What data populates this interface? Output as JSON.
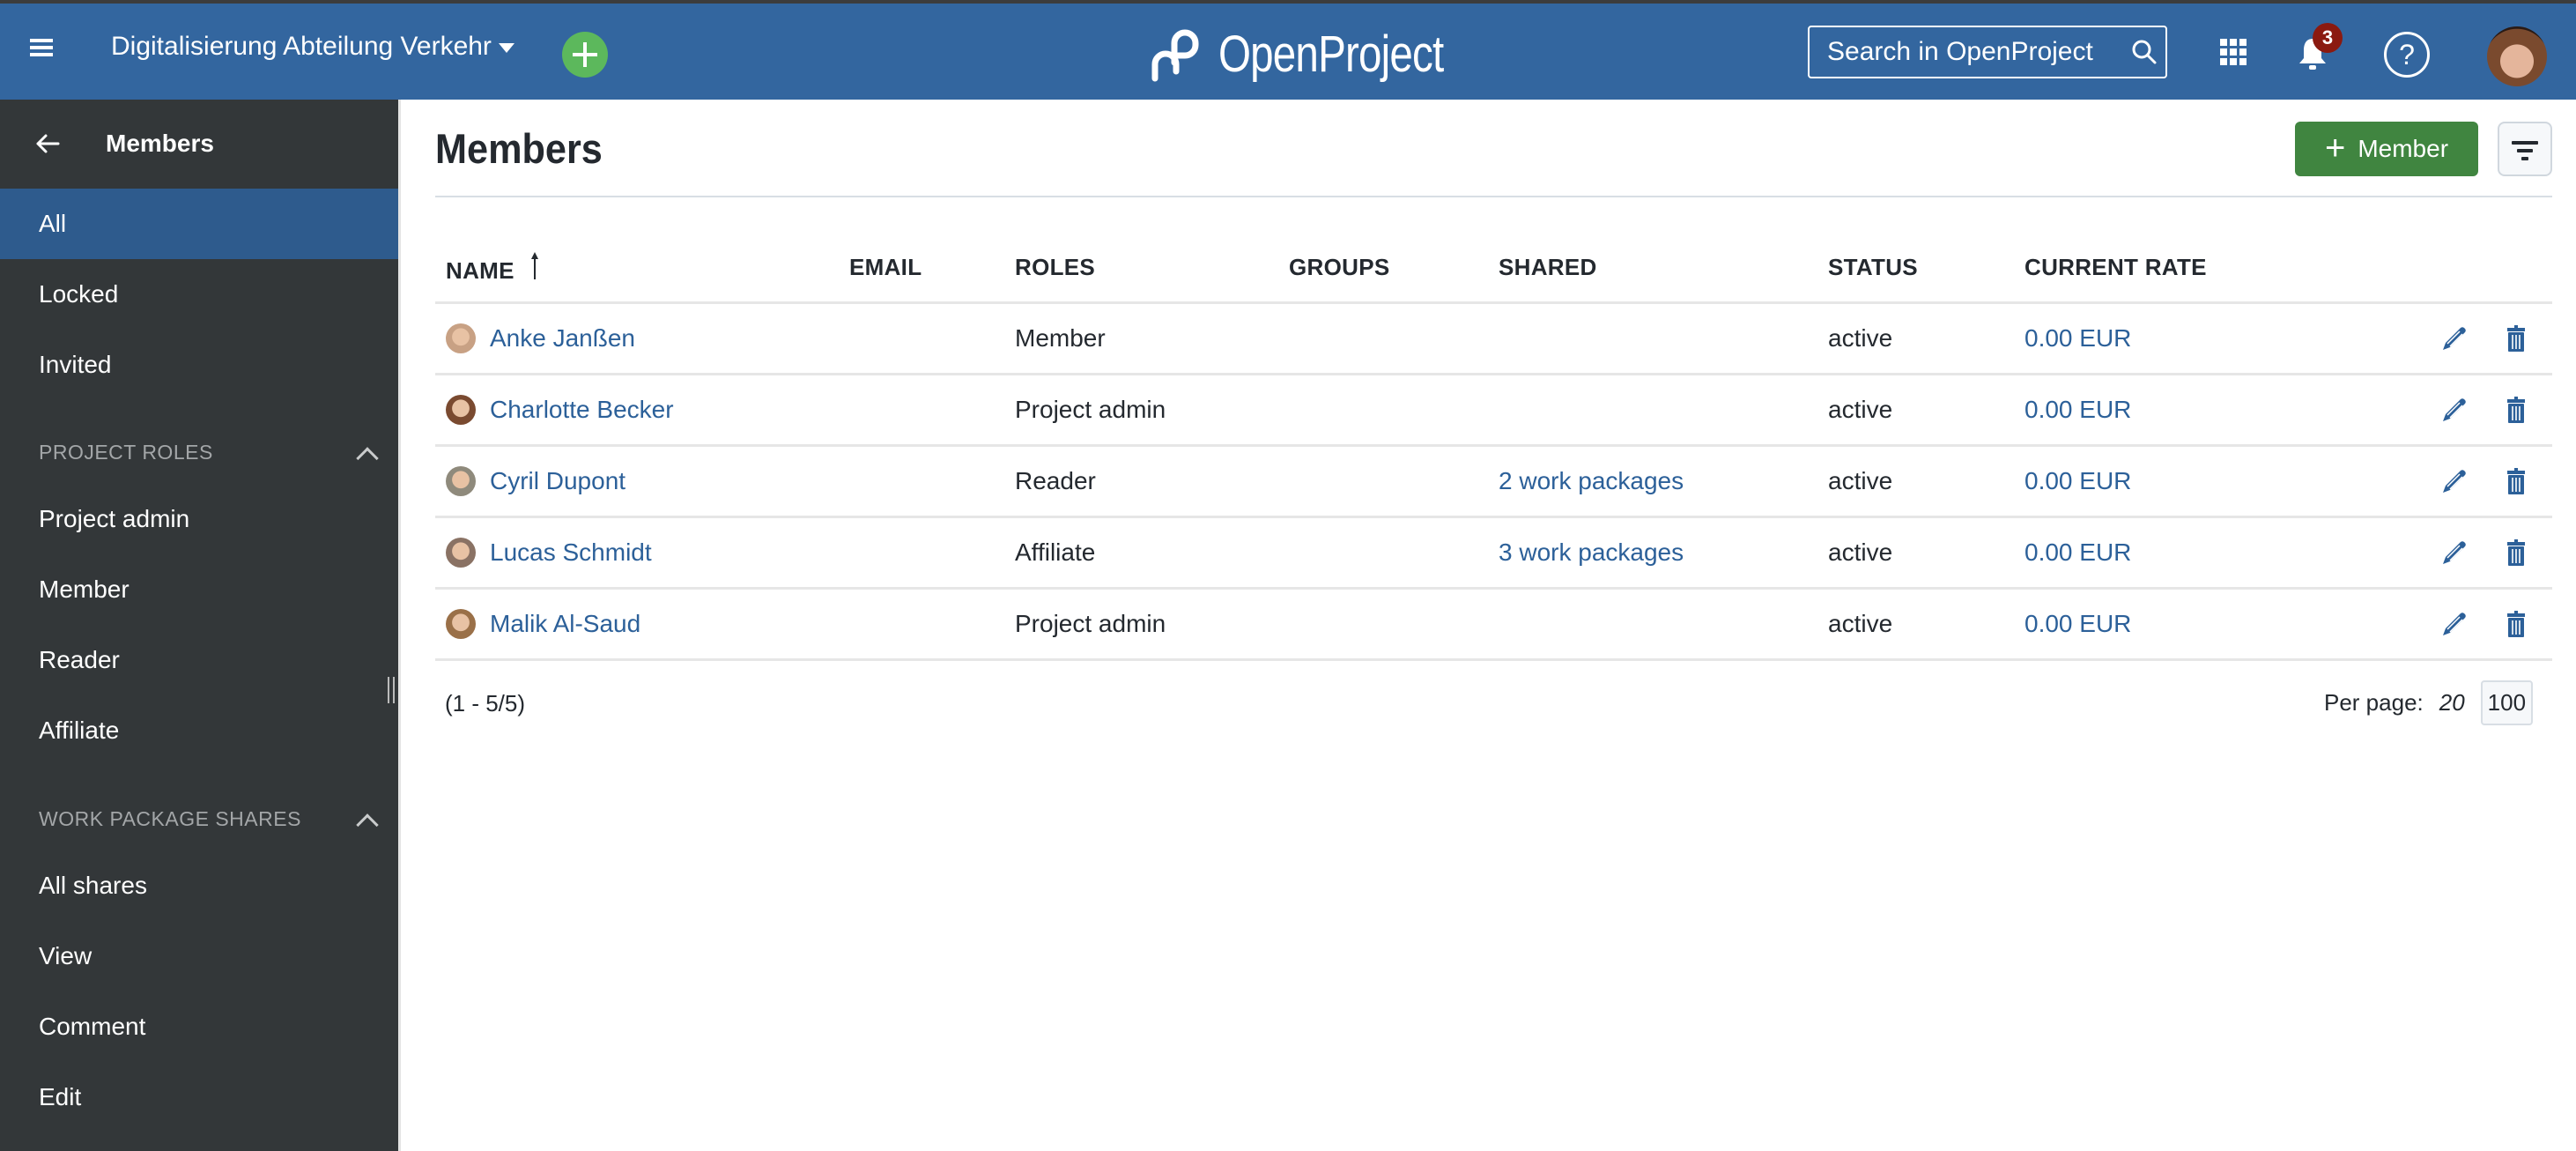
{
  "header": {
    "project_name": "Digitalisierung Abteilung Verkehr",
    "logo_text": "OpenProject",
    "search_placeholder": "Search in OpenProject",
    "notification_count": "3",
    "help_label": "?",
    "brand_color": "#33669f"
  },
  "sidebar": {
    "title": "Members",
    "items": [
      {
        "label": "All",
        "active": true
      },
      {
        "label": "Locked"
      },
      {
        "label": "Invited"
      }
    ],
    "sections": [
      {
        "title": "PROJECT ROLES",
        "items": [
          {
            "label": "Project admin"
          },
          {
            "label": "Member"
          },
          {
            "label": "Reader"
          },
          {
            "label": "Affiliate"
          }
        ]
      },
      {
        "title": "WORK PACKAGE SHARES",
        "items": [
          {
            "label": "All shares"
          },
          {
            "label": "View"
          },
          {
            "label": "Comment"
          },
          {
            "label": "Edit"
          }
        ]
      }
    ]
  },
  "main": {
    "title": "Members",
    "add_button_label": "Member",
    "columns": [
      "NAME",
      "EMAIL",
      "ROLES",
      "GROUPS",
      "SHARED",
      "STATUS",
      "CURRENT RATE"
    ],
    "sort": {
      "column": "NAME",
      "direction": "ascending"
    },
    "rows": [
      {
        "name": "Anke Janßen",
        "email": "",
        "roles": "Member",
        "groups": "",
        "shared": "",
        "status": "active",
        "rate": "0.00 EUR",
        "avatar_color": "#c8a184"
      },
      {
        "name": "Charlotte Becker",
        "email": "",
        "roles": "Project admin",
        "groups": "",
        "shared": "",
        "status": "active",
        "rate": "0.00 EUR",
        "avatar_color": "#7a4a30"
      },
      {
        "name": "Cyril Dupont",
        "email": "",
        "roles": "Reader",
        "groups": "",
        "shared": "2 work packages",
        "status": "active",
        "rate": "0.00 EUR",
        "avatar_color": "#8f8a7c"
      },
      {
        "name": "Lucas Schmidt",
        "email": "",
        "roles": "Affiliate",
        "groups": "",
        "shared": "3 work packages",
        "status": "active",
        "rate": "0.00 EUR",
        "avatar_color": "#8a7264"
      },
      {
        "name": "Malik Al-Saud",
        "email": "",
        "roles": "Project admin",
        "groups": "",
        "shared": "",
        "status": "active",
        "rate": "0.00 EUR",
        "avatar_color": "#9a7048"
      }
    ],
    "pagination": {
      "range_text": "(1 - 5/5)",
      "per_page_label": "Per page:",
      "per_page_options": [
        "20",
        "100"
      ],
      "per_page_selected": "100"
    }
  }
}
